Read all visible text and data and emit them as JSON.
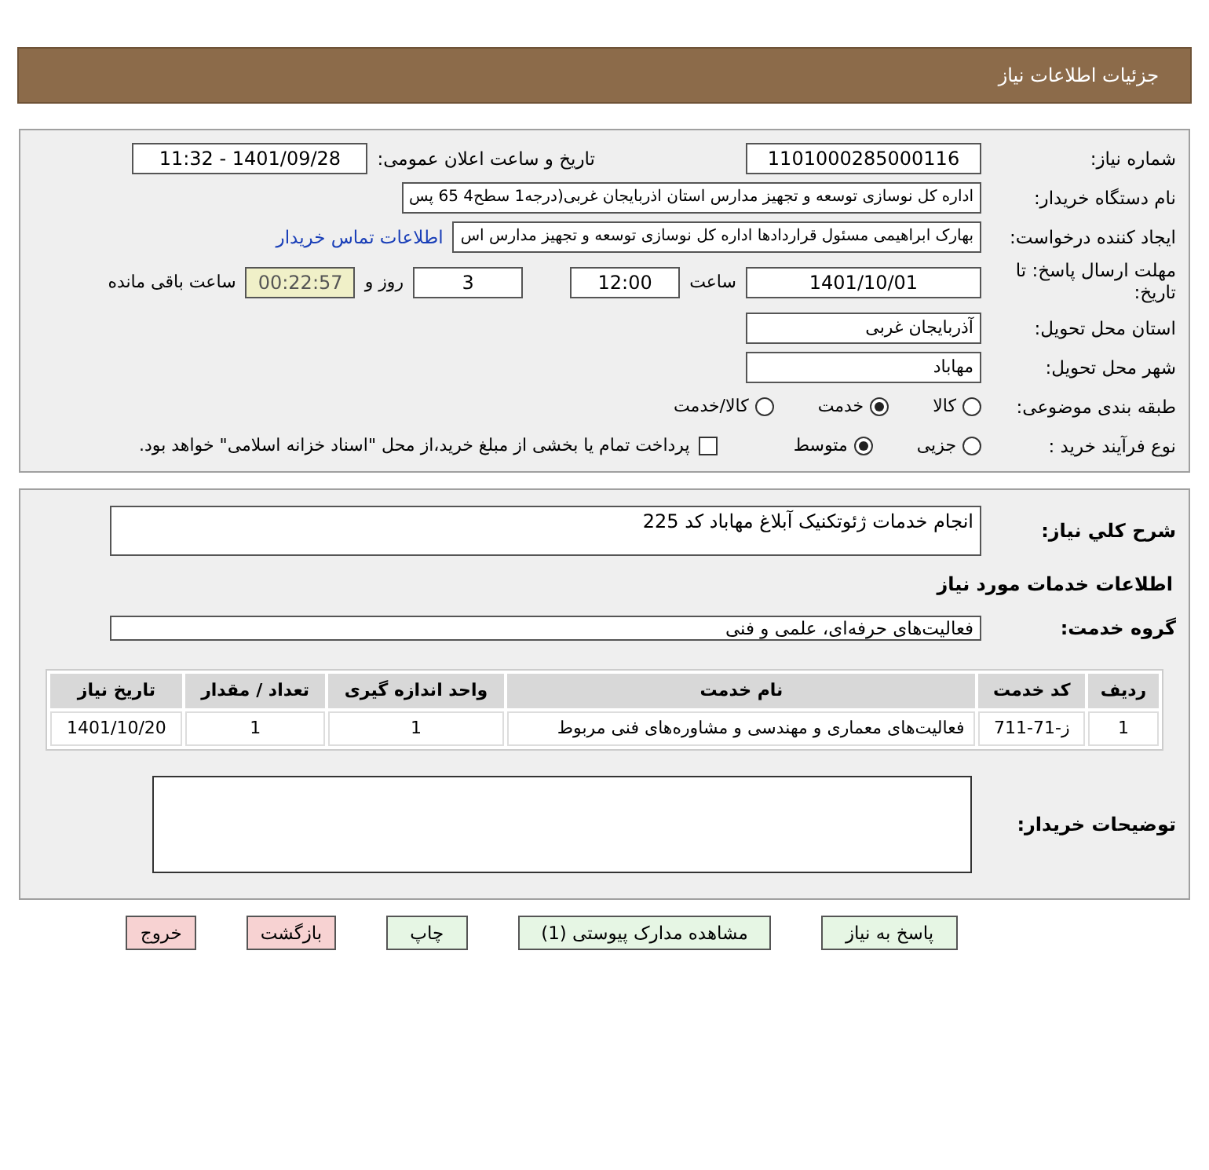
{
  "header": {
    "title": "جزئیات اطلاعات نیاز"
  },
  "need_number": {
    "label": "شماره نیاز:",
    "value": "1101000285000116"
  },
  "announce_date": {
    "label": "تاریخ و ساعت اعلان عمومی:",
    "value": "1401/09/28 - 11:32"
  },
  "buyer_org": {
    "label": "نام دستگاه خریدار:",
    "value": "اداره کل نوسازی   توسعه و تجهیز مدارس استان اذربایجان غربی(درجه1  سطح4  65 پس"
  },
  "requester": {
    "label": "ایجاد کننده درخواست:",
    "value": "بهارک ابراهیمی مسئول قراردادها اداره کل نوسازی   توسعه و تجهیز مدارس اس",
    "link": "اطلاعات تماس خریدار"
  },
  "deadline": {
    "label": "مهلت ارسال پاسخ: تا تاریخ:",
    "date": "1401/10/01",
    "time_label": "ساعت",
    "time": "12:00",
    "days": "3",
    "days_label": "روز و",
    "remaining": "00:22:57",
    "remaining_label": "ساعت باقی مانده"
  },
  "province": {
    "label": "استان محل تحویل:",
    "value": "آذربایجان غربی"
  },
  "city": {
    "label": "شهر محل تحویل:",
    "value": "مهاباد"
  },
  "category": {
    "label": "طبقه بندی موضوعی:",
    "options": [
      {
        "label": "کالا",
        "selected": false
      },
      {
        "label": "خدمت",
        "selected": true
      },
      {
        "label": "کالا/خدمت",
        "selected": false
      }
    ]
  },
  "purchase_type": {
    "label": "نوع فرآیند خرید :",
    "options": [
      {
        "label": "جزیی",
        "selected": false
      },
      {
        "label": "متوسط",
        "selected": true
      }
    ],
    "treasury": {
      "label": "پرداخت تمام یا بخشی از مبلغ خرید،از محل \"اسناد خزانه اسلامی\" خواهد بود.",
      "checked": false
    }
  },
  "description": {
    "label": "شرح کلي نياز:",
    "value": "انجام خدمات ژئوتکنیک آبلاغ مهاباد کد 225"
  },
  "services_title": "اطلاعات خدمات مورد نیاز",
  "service_group": {
    "label": "گروه خدمت:",
    "value": "فعالیت‌های حرفه‌ای، علمی و فنی"
  },
  "table": {
    "columns": [
      "ردیف",
      "کد خدمت",
      "نام خدمت",
      "واحد اندازه گیری",
      "تعداد / مقدار",
      "تاریخ نیاز"
    ],
    "rows": [
      [
        "1",
        "ز-71-711",
        "فعالیت‌های معماری و مهندسی و مشاوره‌های فنی مربوط",
        "1",
        "1",
        "1401/10/20"
      ]
    ]
  },
  "buyer_notes": {
    "label": "توضیحات خریدار:"
  },
  "buttons": [
    {
      "label": "پاسخ به نیاز",
      "kind": "normal"
    },
    {
      "label": "مشاهده مدارک پیوستی (1)",
      "kind": "normal"
    },
    {
      "label": "چاپ",
      "kind": "normal"
    },
    {
      "label": "بازگشت",
      "kind": "danger"
    },
    {
      "label": "خروج",
      "kind": "danger"
    }
  ]
}
